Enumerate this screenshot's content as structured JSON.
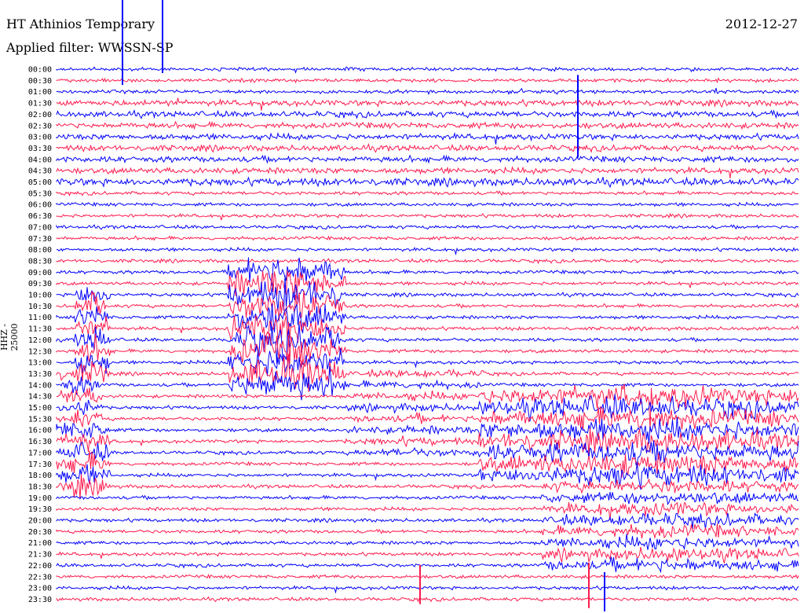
{
  "header": {
    "station": "HT Athinios Temporary",
    "filter": "Applied filter: WWSSN-SP",
    "date": "2012-12-27"
  },
  "chart_data": {
    "type": "line",
    "title": "HT Athinios Temporary",
    "subtitle": "Applied filter: WWSSN-SP",
    "date": "2012-12-27",
    "ylabel": "HHZ - 25000",
    "row_labels": [
      "00:00",
      "00:30",
      "01:00",
      "01:30",
      "02:00",
      "02:30",
      "03:00",
      "03:30",
      "04:00",
      "04:30",
      "05:00",
      "05:30",
      "06:00",
      "06:30",
      "07:00",
      "07:30",
      "08:00",
      "08:30",
      "09:00",
      "09:30",
      "10:00",
      "10:30",
      "11:00",
      "11:30",
      "12:00",
      "12:30",
      "13:00",
      "13:30",
      "14:00",
      "14:30",
      "15:00",
      "15:30",
      "16:00",
      "16:30",
      "17:00",
      "17:30",
      "18:00",
      "18:30",
      "19:00",
      "19:30",
      "20:00",
      "20:30",
      "21:00",
      "21:30",
      "22:00",
      "22:30",
      "23:00",
      "23:30"
    ],
    "colors": [
      "#0000ff",
      "#ff1a4d"
    ],
    "series_pattern": "alternating traces, blue then red"
  }
}
